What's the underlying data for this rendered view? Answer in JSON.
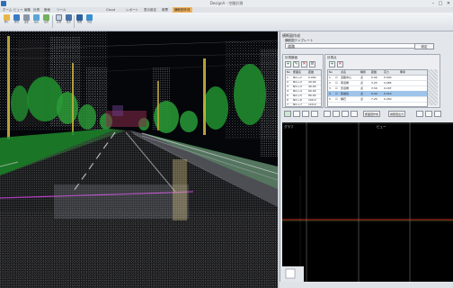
{
  "window": {
    "title": "DesignA - 空間計測",
    "minimize_glyph": "–",
    "maximize_glyph": "□",
    "close_glyph": "✕"
  },
  "ribbon_tabs": [
    "ホーム",
    "ビュー",
    "編集",
    "計測",
    "断面",
    "ツール",
    "Cloud",
    "レポート",
    "表示設定",
    "帳票",
    "横断図作成"
  ],
  "ribbon_buttons": [
    {
      "label": "開く",
      "icon": "folder-icon"
    },
    {
      "label": "保存",
      "icon": "save-icon"
    },
    {
      "label": "設定",
      "icon": "settings-icon"
    },
    {
      "label": "読込",
      "icon": "import-icon"
    },
    {
      "label": "出力",
      "icon": "export-icon"
    },
    {
      "label": "計測",
      "icon": "measure-icon"
    },
    {
      "label": "表示",
      "icon": "view-icon"
    },
    {
      "label": "断面",
      "icon": "section-icon"
    },
    {
      "label": "作成",
      "icon": "create-icon"
    }
  ],
  "panel": {
    "header": "横断図作成",
    "section_label": "横断図テンプレート",
    "template_value": "道路",
    "ok_label": "設定",
    "left_group": {
      "title": "計測断面",
      "columns": [
        "No",
        "断面名",
        "距離"
      ],
      "rows": [
        [
          "1",
          "NO.+1",
          "0.000"
        ],
        [
          "2",
          "NO.+2",
          "20.00"
        ],
        [
          "3",
          "NO.+3",
          "40.00"
        ],
        [
          "4",
          "NO.+4",
          "60.00"
        ],
        [
          "5",
          "NO.+5",
          "80.00"
        ],
        [
          "6",
          "NO.+6",
          "100.0"
        ],
        [
          "7",
          "NO.+7",
          "120.0"
        ]
      ]
    },
    "right_group": {
      "title": "計測点",
      "columns": [
        "No",
        "",
        "点名",
        "種別",
        "距離",
        "高さ",
        "備考"
      ],
      "rows": [
        [
          "1",
          "☑",
          "道路中心",
          "点",
          "0.00",
          "0.000",
          ""
        ],
        [
          "2",
          "☑",
          "車道端",
          "点",
          "3.25",
          "0.085",
          ""
        ],
        [
          "3",
          "☑",
          "歩道端",
          "点",
          "3.50",
          "0.187",
          ""
        ],
        [
          "4",
          "☑",
          "民地境",
          "点",
          "6.00",
          "0.210",
          ""
        ],
        [
          "5",
          "☑",
          "縁石",
          "点",
          "7.25",
          "0.250",
          ""
        ]
      ]
    },
    "section_buttons": [
      "断面図作成",
      "横断図出力"
    ],
    "profile_labels": {
      "left_tab": "グラフ",
      "right_tab": "ビュー"
    }
  },
  "colors": {
    "accent_tab": "#f2b25a",
    "selection": "#9fc4ea",
    "grid_line": "#ffffff",
    "profile_red": "#d8342c"
  }
}
